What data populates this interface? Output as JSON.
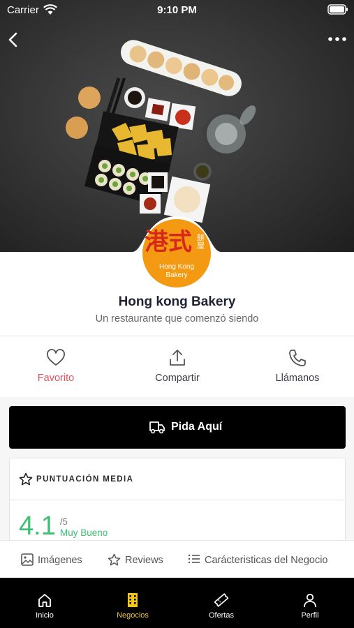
{
  "status": {
    "carrier": "Carrier",
    "time": "9:10 PM"
  },
  "business": {
    "name": "Hong kong Bakery",
    "description": "Un restaurante que comenzó siendo",
    "logo_text_cn_big": "港式",
    "logo_text_cn_small": "餅屋",
    "logo_line1": "Hong Kong",
    "logo_line2": "Bakery"
  },
  "actions": [
    {
      "label": "Favorito",
      "icon": "heart-icon"
    },
    {
      "label": "Compartir",
      "icon": "share-icon"
    },
    {
      "label": "Llámanos",
      "icon": "phone-icon"
    }
  ],
  "order": {
    "label": "Pida Aquí",
    "icon": "truck-icon"
  },
  "rating": {
    "title": "PUNTUACIÓN MEDIA",
    "score": "4.1",
    "max": "/5",
    "word": "Muy Bueno"
  },
  "tabs": [
    {
      "label": "Imágenes",
      "icon": "image-icon"
    },
    {
      "label": "Reviews",
      "icon": "star-icon"
    },
    {
      "label": "Carácteristicas del Negocio",
      "icon": "list-icon"
    }
  ],
  "nav": [
    {
      "label": "Inicio",
      "icon": "home-icon",
      "active": false
    },
    {
      "label": "Negocios",
      "icon": "building-icon",
      "active": true
    },
    {
      "label": "Ofertas",
      "icon": "ticket-icon",
      "active": false
    },
    {
      "label": "Perfil",
      "icon": "user-icon",
      "active": false
    }
  ],
  "colors": {
    "accent_active": "#f5c518",
    "favorite": "#e8505b",
    "rating": "#3fbf73",
    "logo": "#f39a12"
  }
}
